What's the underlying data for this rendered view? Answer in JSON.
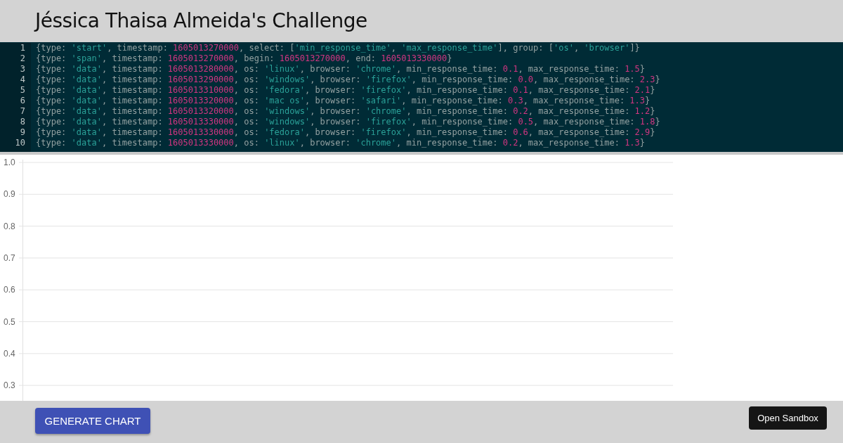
{
  "header": {
    "title": "Jéssica Thaisa Almeida's Challenge"
  },
  "editor": {
    "lines": [
      {
        "number": "1",
        "tokens": [
          {
            "kind": "plain",
            "text": "{type: "
          },
          {
            "kind": "string",
            "text": "'start'"
          },
          {
            "kind": "plain",
            "text": ", timestamp: "
          },
          {
            "kind": "number",
            "text": "1605013270000"
          },
          {
            "kind": "plain",
            "text": ", select: ["
          },
          {
            "kind": "string",
            "text": "'min_response_time'"
          },
          {
            "kind": "plain",
            "text": ", "
          },
          {
            "kind": "string",
            "text": "'max_response_time'"
          },
          {
            "kind": "plain",
            "text": "], group: ["
          },
          {
            "kind": "string",
            "text": "'os'"
          },
          {
            "kind": "plain",
            "text": ", "
          },
          {
            "kind": "string",
            "text": "'browser'"
          },
          {
            "kind": "plain",
            "text": "]}"
          }
        ]
      },
      {
        "number": "2",
        "tokens": [
          {
            "kind": "plain",
            "text": "{type: "
          },
          {
            "kind": "string",
            "text": "'span'"
          },
          {
            "kind": "plain",
            "text": ", timestamp: "
          },
          {
            "kind": "number",
            "text": "1605013270000"
          },
          {
            "kind": "plain",
            "text": ", begin: "
          },
          {
            "kind": "number",
            "text": "1605013270000"
          },
          {
            "kind": "plain",
            "text": ", end: "
          },
          {
            "kind": "number",
            "text": "1605013330000"
          },
          {
            "kind": "plain",
            "text": "}"
          }
        ]
      },
      {
        "number": "3",
        "tokens": [
          {
            "kind": "plain",
            "text": "{type: "
          },
          {
            "kind": "string",
            "text": "'data'"
          },
          {
            "kind": "plain",
            "text": ", timestamp: "
          },
          {
            "kind": "number",
            "text": "1605013280000"
          },
          {
            "kind": "plain",
            "text": ", os: "
          },
          {
            "kind": "string",
            "text": "'linux'"
          },
          {
            "kind": "plain",
            "text": ", browser: "
          },
          {
            "kind": "string",
            "text": "'chrome'"
          },
          {
            "kind": "plain",
            "text": ", min_response_time: "
          },
          {
            "kind": "number",
            "text": "0.1"
          },
          {
            "kind": "plain",
            "text": ", max_response_time: "
          },
          {
            "kind": "number",
            "text": "1.5"
          },
          {
            "kind": "plain",
            "text": "}"
          }
        ]
      },
      {
        "number": "4",
        "tokens": [
          {
            "kind": "plain",
            "text": "{type: "
          },
          {
            "kind": "string",
            "text": "'data'"
          },
          {
            "kind": "plain",
            "text": ", timestamp: "
          },
          {
            "kind": "number",
            "text": "1605013290000"
          },
          {
            "kind": "plain",
            "text": ", os: "
          },
          {
            "kind": "string",
            "text": "'windows'"
          },
          {
            "kind": "plain",
            "text": ", browser: "
          },
          {
            "kind": "string",
            "text": "'firefox'"
          },
          {
            "kind": "plain",
            "text": ", min_response_time: "
          },
          {
            "kind": "number",
            "text": "0.0"
          },
          {
            "kind": "plain",
            "text": ", max_response_time: "
          },
          {
            "kind": "number",
            "text": "2.3"
          },
          {
            "kind": "plain",
            "text": "}"
          }
        ]
      },
      {
        "number": "5",
        "tokens": [
          {
            "kind": "plain",
            "text": "{type: "
          },
          {
            "kind": "string",
            "text": "'data'"
          },
          {
            "kind": "plain",
            "text": ", timestamp: "
          },
          {
            "kind": "number",
            "text": "1605013310000"
          },
          {
            "kind": "plain",
            "text": ", os: "
          },
          {
            "kind": "string",
            "text": "'fedora'"
          },
          {
            "kind": "plain",
            "text": ", browser: "
          },
          {
            "kind": "string",
            "text": "'firefox'"
          },
          {
            "kind": "plain",
            "text": ", min_response_time: "
          },
          {
            "kind": "number",
            "text": "0.1"
          },
          {
            "kind": "plain",
            "text": ", max_response_time: "
          },
          {
            "kind": "number",
            "text": "2.1"
          },
          {
            "kind": "plain",
            "text": "}"
          }
        ]
      },
      {
        "number": "6",
        "tokens": [
          {
            "kind": "plain",
            "text": "{type: "
          },
          {
            "kind": "string",
            "text": "'data'"
          },
          {
            "kind": "plain",
            "text": ", timestamp: "
          },
          {
            "kind": "number",
            "text": "1605013320000"
          },
          {
            "kind": "plain",
            "text": ", os: "
          },
          {
            "kind": "string",
            "text": "'mac os'"
          },
          {
            "kind": "plain",
            "text": ", browser: "
          },
          {
            "kind": "string",
            "text": "'safari'"
          },
          {
            "kind": "plain",
            "text": ", min_response_time: "
          },
          {
            "kind": "number",
            "text": "0.3"
          },
          {
            "kind": "plain",
            "text": ", max_response_time: "
          },
          {
            "kind": "number",
            "text": "1.3"
          },
          {
            "kind": "plain",
            "text": "}"
          }
        ]
      },
      {
        "number": "7",
        "tokens": [
          {
            "kind": "plain",
            "text": "{type: "
          },
          {
            "kind": "string",
            "text": "'data'"
          },
          {
            "kind": "plain",
            "text": ", timestamp: "
          },
          {
            "kind": "number",
            "text": "1605013320000"
          },
          {
            "kind": "plain",
            "text": ", os: "
          },
          {
            "kind": "string",
            "text": "'windows'"
          },
          {
            "kind": "plain",
            "text": ", browser: "
          },
          {
            "kind": "string",
            "text": "'chrome'"
          },
          {
            "kind": "plain",
            "text": ", min_response_time: "
          },
          {
            "kind": "number",
            "text": "0.2"
          },
          {
            "kind": "plain",
            "text": ", max_response_time: "
          },
          {
            "kind": "number",
            "text": "1.2"
          },
          {
            "kind": "plain",
            "text": "}"
          }
        ]
      },
      {
        "number": "8",
        "tokens": [
          {
            "kind": "plain",
            "text": "{type: "
          },
          {
            "kind": "string",
            "text": "'data'"
          },
          {
            "kind": "plain",
            "text": ", timestamp: "
          },
          {
            "kind": "number",
            "text": "1605013330000"
          },
          {
            "kind": "plain",
            "text": ", os: "
          },
          {
            "kind": "string",
            "text": "'windows'"
          },
          {
            "kind": "plain",
            "text": ", browser: "
          },
          {
            "kind": "string",
            "text": "'firefox'"
          },
          {
            "kind": "plain",
            "text": ", min_response_time: "
          },
          {
            "kind": "number",
            "text": "0.5"
          },
          {
            "kind": "plain",
            "text": ", max_response_time: "
          },
          {
            "kind": "number",
            "text": "1.8"
          },
          {
            "kind": "plain",
            "text": "}"
          }
        ]
      },
      {
        "number": "9",
        "tokens": [
          {
            "kind": "plain",
            "text": "{type: "
          },
          {
            "kind": "string",
            "text": "'data'"
          },
          {
            "kind": "plain",
            "text": ", timestamp: "
          },
          {
            "kind": "number",
            "text": "1605013330000"
          },
          {
            "kind": "plain",
            "text": ", os: "
          },
          {
            "kind": "string",
            "text": "'fedora'"
          },
          {
            "kind": "plain",
            "text": ", browser: "
          },
          {
            "kind": "string",
            "text": "'firefox'"
          },
          {
            "kind": "plain",
            "text": ", min_response_time: "
          },
          {
            "kind": "number",
            "text": "0.6"
          },
          {
            "kind": "plain",
            "text": ", max_response_time: "
          },
          {
            "kind": "number",
            "text": "2.9"
          },
          {
            "kind": "plain",
            "text": "}"
          }
        ]
      },
      {
        "number": "10",
        "tokens": [
          {
            "kind": "plain",
            "text": "{type: "
          },
          {
            "kind": "string",
            "text": "'data'"
          },
          {
            "kind": "plain",
            "text": ", timestamp: "
          },
          {
            "kind": "number",
            "text": "1605013330000"
          },
          {
            "kind": "plain",
            "text": ", os: "
          },
          {
            "kind": "string",
            "text": "'linux'"
          },
          {
            "kind": "plain",
            "text": ", browser: "
          },
          {
            "kind": "string",
            "text": "'chrome'"
          },
          {
            "kind": "plain",
            "text": ", min_response_time: "
          },
          {
            "kind": "number",
            "text": "0.2"
          },
          {
            "kind": "plain",
            "text": ", max_response_time: "
          },
          {
            "kind": "number",
            "text": "1.3"
          },
          {
            "kind": "plain",
            "text": "}"
          }
        ]
      }
    ]
  },
  "chart": {
    "y_axis_labels": [
      "1.0",
      "0.9",
      "0.8",
      "0.7",
      "0.6",
      "0.5",
      "0.4",
      "0.3"
    ]
  },
  "footer": {
    "generate_button": "GENERATE CHART",
    "sandbox_button": "Open Sandbox"
  }
}
